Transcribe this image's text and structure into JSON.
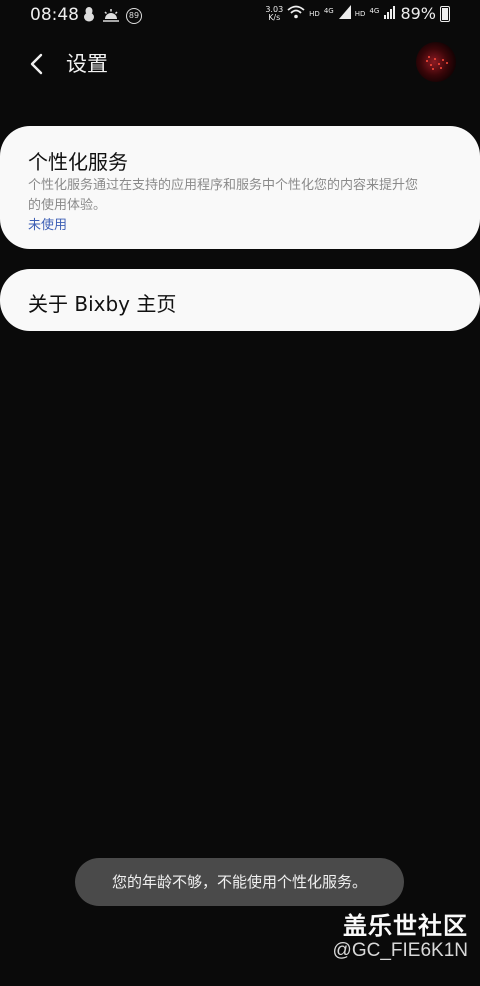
{
  "status_bar": {
    "time": "08:48",
    "notification_badge": "89",
    "net_speed_value": "3.03",
    "net_speed_unit": "K/s",
    "hd_1": "HD",
    "lte_1": "4G",
    "hd_2": "HD",
    "lte_2": "4G",
    "battery": "89%"
  },
  "header": {
    "title": "设置"
  },
  "personalized_card": {
    "title": "个性化服务",
    "description": "个性化服务通过在支持的应用程序和服务中个性化您的内容来提升您的使用体验。",
    "status": "未使用",
    "status_color": "#3d5fb5"
  },
  "bixby_card": {
    "label": "关于 Bixby 主页"
  },
  "toast": {
    "message": "您的年龄不够，不能使用个性化服务。"
  },
  "watermark": {
    "title": "盖乐世社区",
    "handle": "@GC_FIE6K1N"
  }
}
